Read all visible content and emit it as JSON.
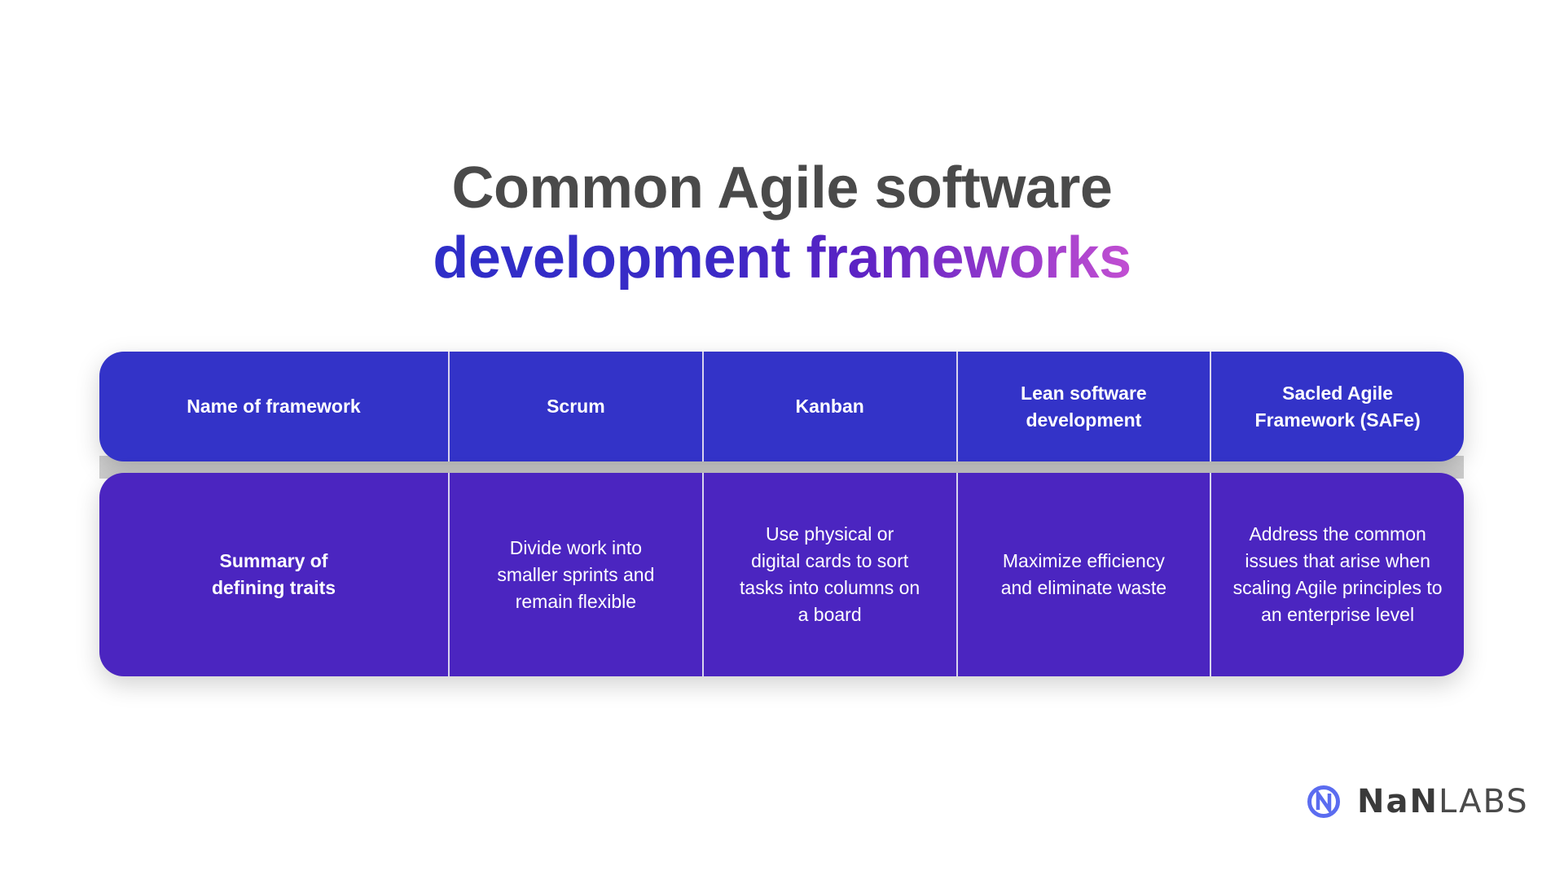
{
  "title": {
    "line1": "Common Agile software",
    "line2": "development frameworks",
    "gradient_colors": [
      "#2e2ec8",
      "#5a22c4",
      "#c24fd2"
    ],
    "line1_color": "#4a4a4a"
  },
  "table": {
    "header_color": "#3333c8",
    "body_color": "#4b25c0",
    "header": [
      "Name of framework",
      "Scrum",
      "Kanban",
      "Lean software development",
      "Sacled Agile Framework (SAFe)"
    ],
    "rows": [
      [
        "Summary of defining traits",
        "Divide work into smaller sprints and remain flexible",
        "Use physical or digital cards to sort tasks into columns on a board",
        "Maximize efficiency and eliminate waste",
        "Address the common issues that arise when scaling Agile principles to an enterprise level"
      ]
    ]
  },
  "logo": {
    "icon": "nanlabs-n-circle-icon",
    "text_bold": "NaN",
    "text_light": "LABS",
    "icon_color": "#5b6cf0"
  }
}
